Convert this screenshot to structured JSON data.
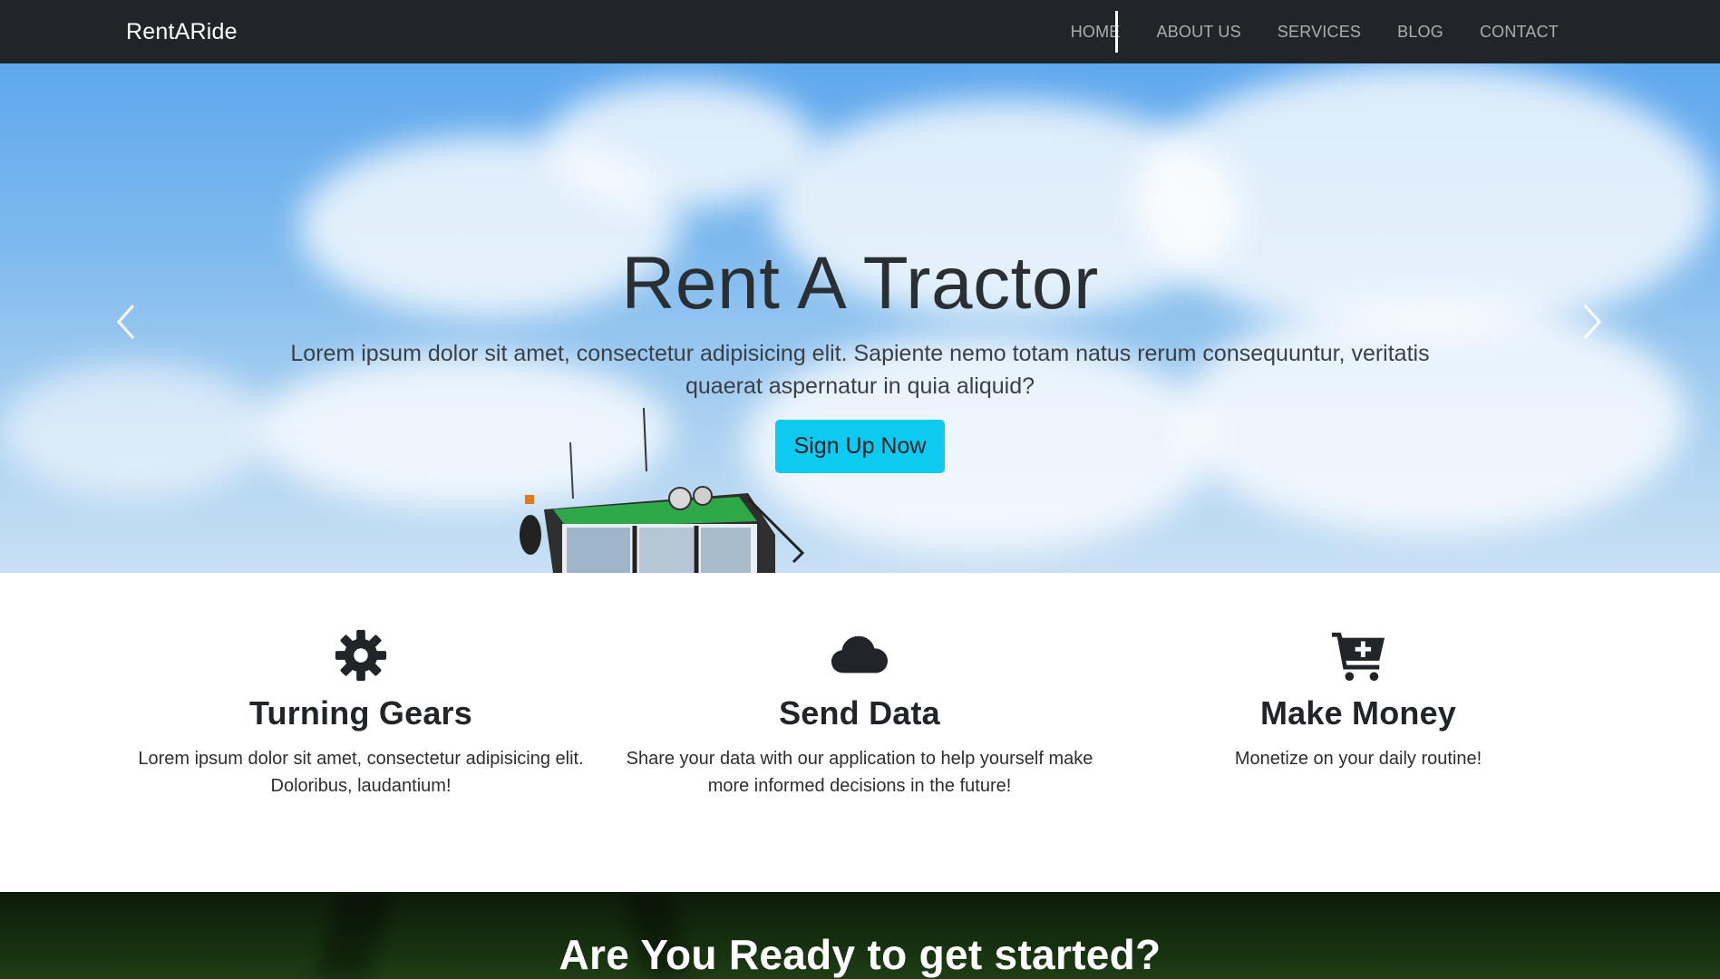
{
  "navbar": {
    "brand": "RentARide",
    "links": [
      "HOME",
      "ABOUT US",
      "SERVICES",
      "BLOG",
      "CONTACT"
    ]
  },
  "hero": {
    "title": "Rent A Tractor",
    "text": "Lorem ipsum dolor sit amet, consectetur adipisicing elit. Sapiente nemo totam natus rerum consequuntur, veritatis quaerat aspernatur in quia aliquid?",
    "cta_label": "Sign Up Now",
    "cta_color": "#0dcaf0"
  },
  "features": [
    {
      "icon": "gear-icon",
      "title": "Turning Gears",
      "text": "Lorem ipsum dolor sit amet, consectetur adipisicing elit. Doloribus, laudantium!"
    },
    {
      "icon": "cloud-icon",
      "title": "Send Data",
      "text": "Share your data with our application to help yourself make more informed decisions in the future!"
    },
    {
      "icon": "cart-plus-icon",
      "title": "Make Money",
      "text": "Monetize on your daily routine!"
    }
  ],
  "cta_band": {
    "title": "Are You Ready to get started?"
  },
  "colors": {
    "navbar_bg": "#212529",
    "accent": "#0dcaf0",
    "text_dark": "#212529"
  }
}
